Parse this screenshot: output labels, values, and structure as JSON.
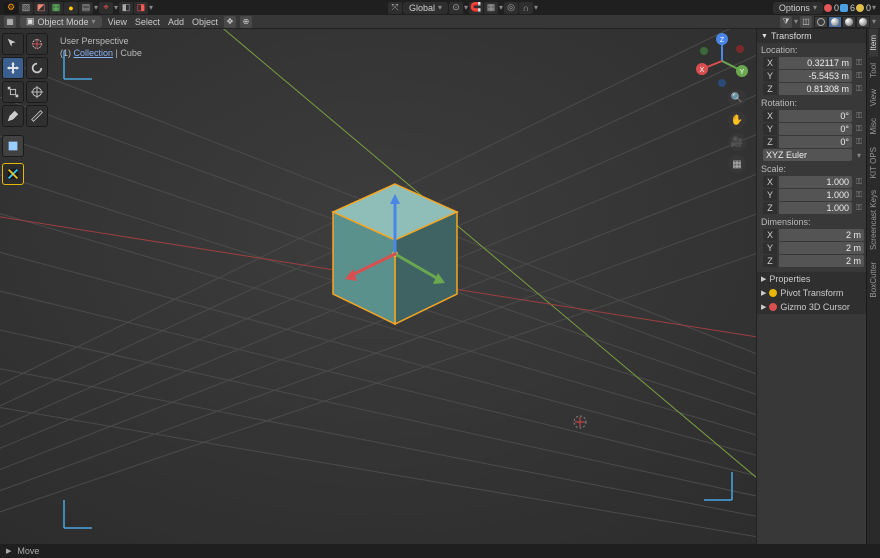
{
  "topbar": {
    "orientation_label": "Global",
    "options_label": "Options",
    "stats": {
      "red": "0",
      "blue": "6",
      "yellow": "0"
    }
  },
  "header": {
    "mode": "Object Mode",
    "menus": [
      "View",
      "Select",
      "Add",
      "Object"
    ]
  },
  "viewport": {
    "view_name": "User Perspective",
    "breadcrumb_prefix": "(1)",
    "breadcrumb_collection": "Collection",
    "breadcrumb_sep": " | ",
    "breadcrumb_object": "Cube"
  },
  "npanel": {
    "transform_header": "Transform",
    "location_label": "Location:",
    "location": {
      "x": "0.32117 m",
      "y": "-5.5453 m",
      "z": "0.81308 m"
    },
    "rotation_label": "Rotation:",
    "rotation": {
      "x": "0°",
      "y": "0°",
      "z": "0°"
    },
    "rotation_mode": "XYZ Euler",
    "scale_label": "Scale:",
    "scale": {
      "x": "1.000",
      "y": "1.000",
      "z": "1.000"
    },
    "dimensions_label": "Dimensions:",
    "dimensions": {
      "x": "2 m",
      "y": "2 m",
      "z": "2 m"
    },
    "prop_panel": "Properties",
    "pivot_panel": "Pivot Transform",
    "cursor_panel": "Gizmo 3D Cursor",
    "axis": {
      "x": "X",
      "y": "Y",
      "z": "Z"
    }
  },
  "tabs": [
    "Item",
    "Tool",
    "View",
    "Misc",
    "KIT OPS",
    "Screencast Keys",
    "BoxCutter"
  ],
  "statusbar": {
    "operator": "Move"
  },
  "colors": {
    "x_axis": "#a83a3a",
    "y_axis": "#6aa84f",
    "z_axis": "#4a86e8",
    "select": "#f5a623",
    "cube_light": "#6fa7a3",
    "cube_dark": "#3f6363"
  }
}
